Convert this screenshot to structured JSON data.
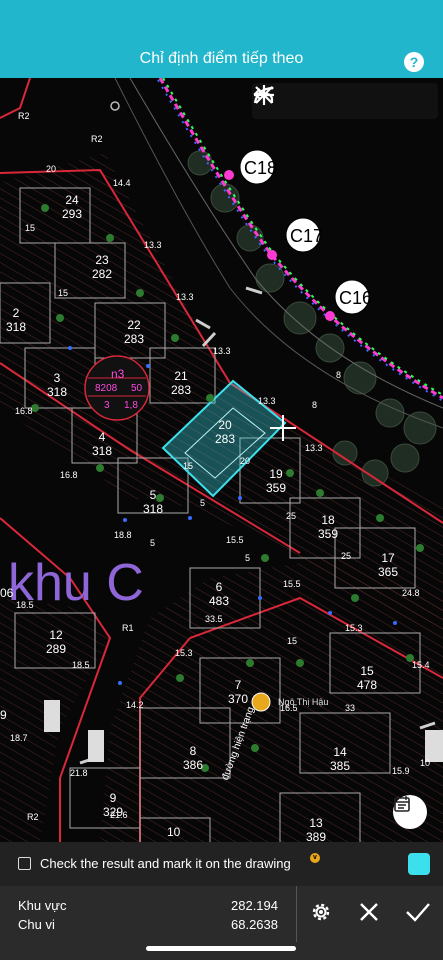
{
  "header": {
    "title": "Chỉ định điểm tiếp theo",
    "help_icon": "question-mark-icon",
    "help_label": "?"
  },
  "toolbar": {
    "tools": [
      "arc-icon",
      "undo-icon",
      "add-icon",
      "close-icon"
    ]
  },
  "map": {
    "zone_label": "khu C",
    "poles": [
      "C18",
      "C17",
      "C16"
    ],
    "info_badge": {
      "name": "n3",
      "line1_a": "8208",
      "line1_b": "50",
      "line2_a": "3",
      "line2_b": "1,8"
    },
    "lots": [
      {
        "id": "24",
        "area": "293"
      },
      {
        "id": "23",
        "area": "282"
      },
      {
        "id": "22",
        "area": "283"
      },
      {
        "id": "21",
        "area": "283"
      },
      {
        "id": "20",
        "area": "283"
      },
      {
        "id": "19",
        "area": "359"
      },
      {
        "id": "18",
        "area": "359"
      },
      {
        "id": "17",
        "area": "365"
      },
      {
        "id": "15",
        "area": "478"
      },
      {
        "id": "14",
        "area": "385"
      },
      {
        "id": "13",
        "area": "389"
      },
      {
        "id": "12",
        "area": "289"
      },
      {
        "id": "10",
        "area": ""
      },
      {
        "id": "9",
        "area": "329"
      },
      {
        "id": "8",
        "area": "386"
      },
      {
        "id": "7",
        "area": "370"
      },
      {
        "id": "6",
        "area": "483"
      },
      {
        "id": "5",
        "area": "318"
      },
      {
        "id": "4",
        "area": "318"
      },
      {
        "id": "3",
        "area": "318"
      },
      {
        "id": "2",
        "area": "318"
      }
    ],
    "dims": [
      "20",
      "14.4",
      "13.3",
      "13.3",
      "13.3",
      "8",
      "8",
      "13.3",
      "13.3",
      "15",
      "15",
      "15",
      "16.8",
      "16.8",
      "18.8",
      "15.5",
      "25",
      "15.5",
      "25",
      "24.8",
      "15.3",
      "15.4",
      "33.5",
      "15",
      "15.3",
      "14.2",
      "18.5",
      "18.5",
      "18.7",
      "21.8",
      "21.6",
      "15.9",
      "33",
      "16.5",
      "20",
      "5",
      "5",
      "5",
      "10",
      "06",
      "9"
    ],
    "road_labels": [
      "R2",
      "R2",
      "R1",
      "R2"
    ],
    "user_name": "Ngô Thị Hậu",
    "street_text": "đường hiện trạng",
    "calendar_icon": "calendar-icon"
  },
  "bottom": {
    "check_label": "Check the result and mark it on the drawing",
    "vip_badge": "v",
    "color_swatch": "#3ce0ec",
    "area_label": "Khu vực",
    "area_value": "282.194",
    "perimeter_label": "Chu vi",
    "perimeter_value": "68.2638",
    "actions": [
      "gear-icon",
      "cancel-icon",
      "confirm-icon"
    ]
  }
}
